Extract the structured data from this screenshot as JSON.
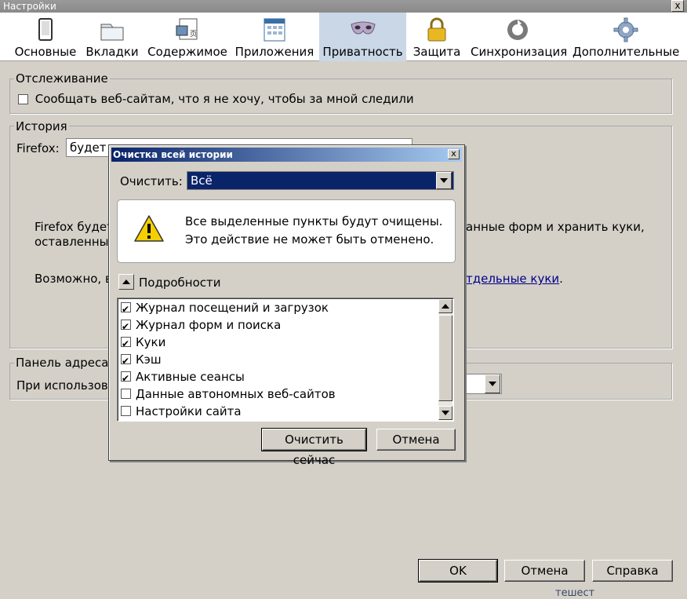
{
  "window": {
    "title": "Настройки",
    "close": "x"
  },
  "toolbar": {
    "tabs": [
      {
        "label": "Основные",
        "icon": "general-icon"
      },
      {
        "label": "Вкладки",
        "icon": "tabs-icon"
      },
      {
        "label": "Содержимое",
        "icon": "content-icon"
      },
      {
        "label": "Приложения",
        "icon": "applications-icon"
      },
      {
        "label": "Приватность",
        "icon": "privacy-mask-icon",
        "active": true
      },
      {
        "label": "Защита",
        "icon": "lock-icon"
      },
      {
        "label": "Синхронизация",
        "icon": "sync-icon"
      },
      {
        "label": "Дополнительные",
        "icon": "gear-icon"
      }
    ]
  },
  "tracking": {
    "legend": "Отслеживание",
    "dnt_label": "Сообщать веб-сайтам, что я не хочу, чтобы за мной следили",
    "dnt_checked": false
  },
  "history": {
    "legend": "История",
    "firefox_label": "Firefox:",
    "mode_value": "будет з",
    "text1_line1": "Firefox будет",
    "text1_line1_tail": "анные форм и хранить куки,",
    "text1_line2": "оставленные",
    "text2": "Возможно, в",
    "link_tail": "тдельные куки",
    "text2_end": "."
  },
  "location_bar": {
    "legend": "Панель адреса",
    "label": "При использова"
  },
  "footer": {
    "ok": "OK",
    "cancel": "Отмена",
    "help": "Справка",
    "cut_text": "тешест"
  },
  "dialog": {
    "title": "Очистка всей истории",
    "close": "x",
    "clear_label": "Очистить:",
    "range_value": "Всё",
    "warning_line1": "Все выделенные пункты будут очищены.",
    "warning_line2": "Это действие не может быть отменено.",
    "details_label": "Подробности",
    "items": [
      {
        "label": "Журнал посещений и загрузок",
        "checked": true
      },
      {
        "label": "Журнал форм и поиска",
        "checked": true
      },
      {
        "label": "Куки",
        "checked": true
      },
      {
        "label": "Кэш",
        "checked": true
      },
      {
        "label": "Активные сеансы",
        "checked": true
      },
      {
        "label": "Данные автономных веб-сайтов",
        "checked": false
      },
      {
        "label": "Настройки сайта",
        "checked": false
      }
    ],
    "clear_now": "Очистить сейчас",
    "cancel": "Отмена"
  }
}
